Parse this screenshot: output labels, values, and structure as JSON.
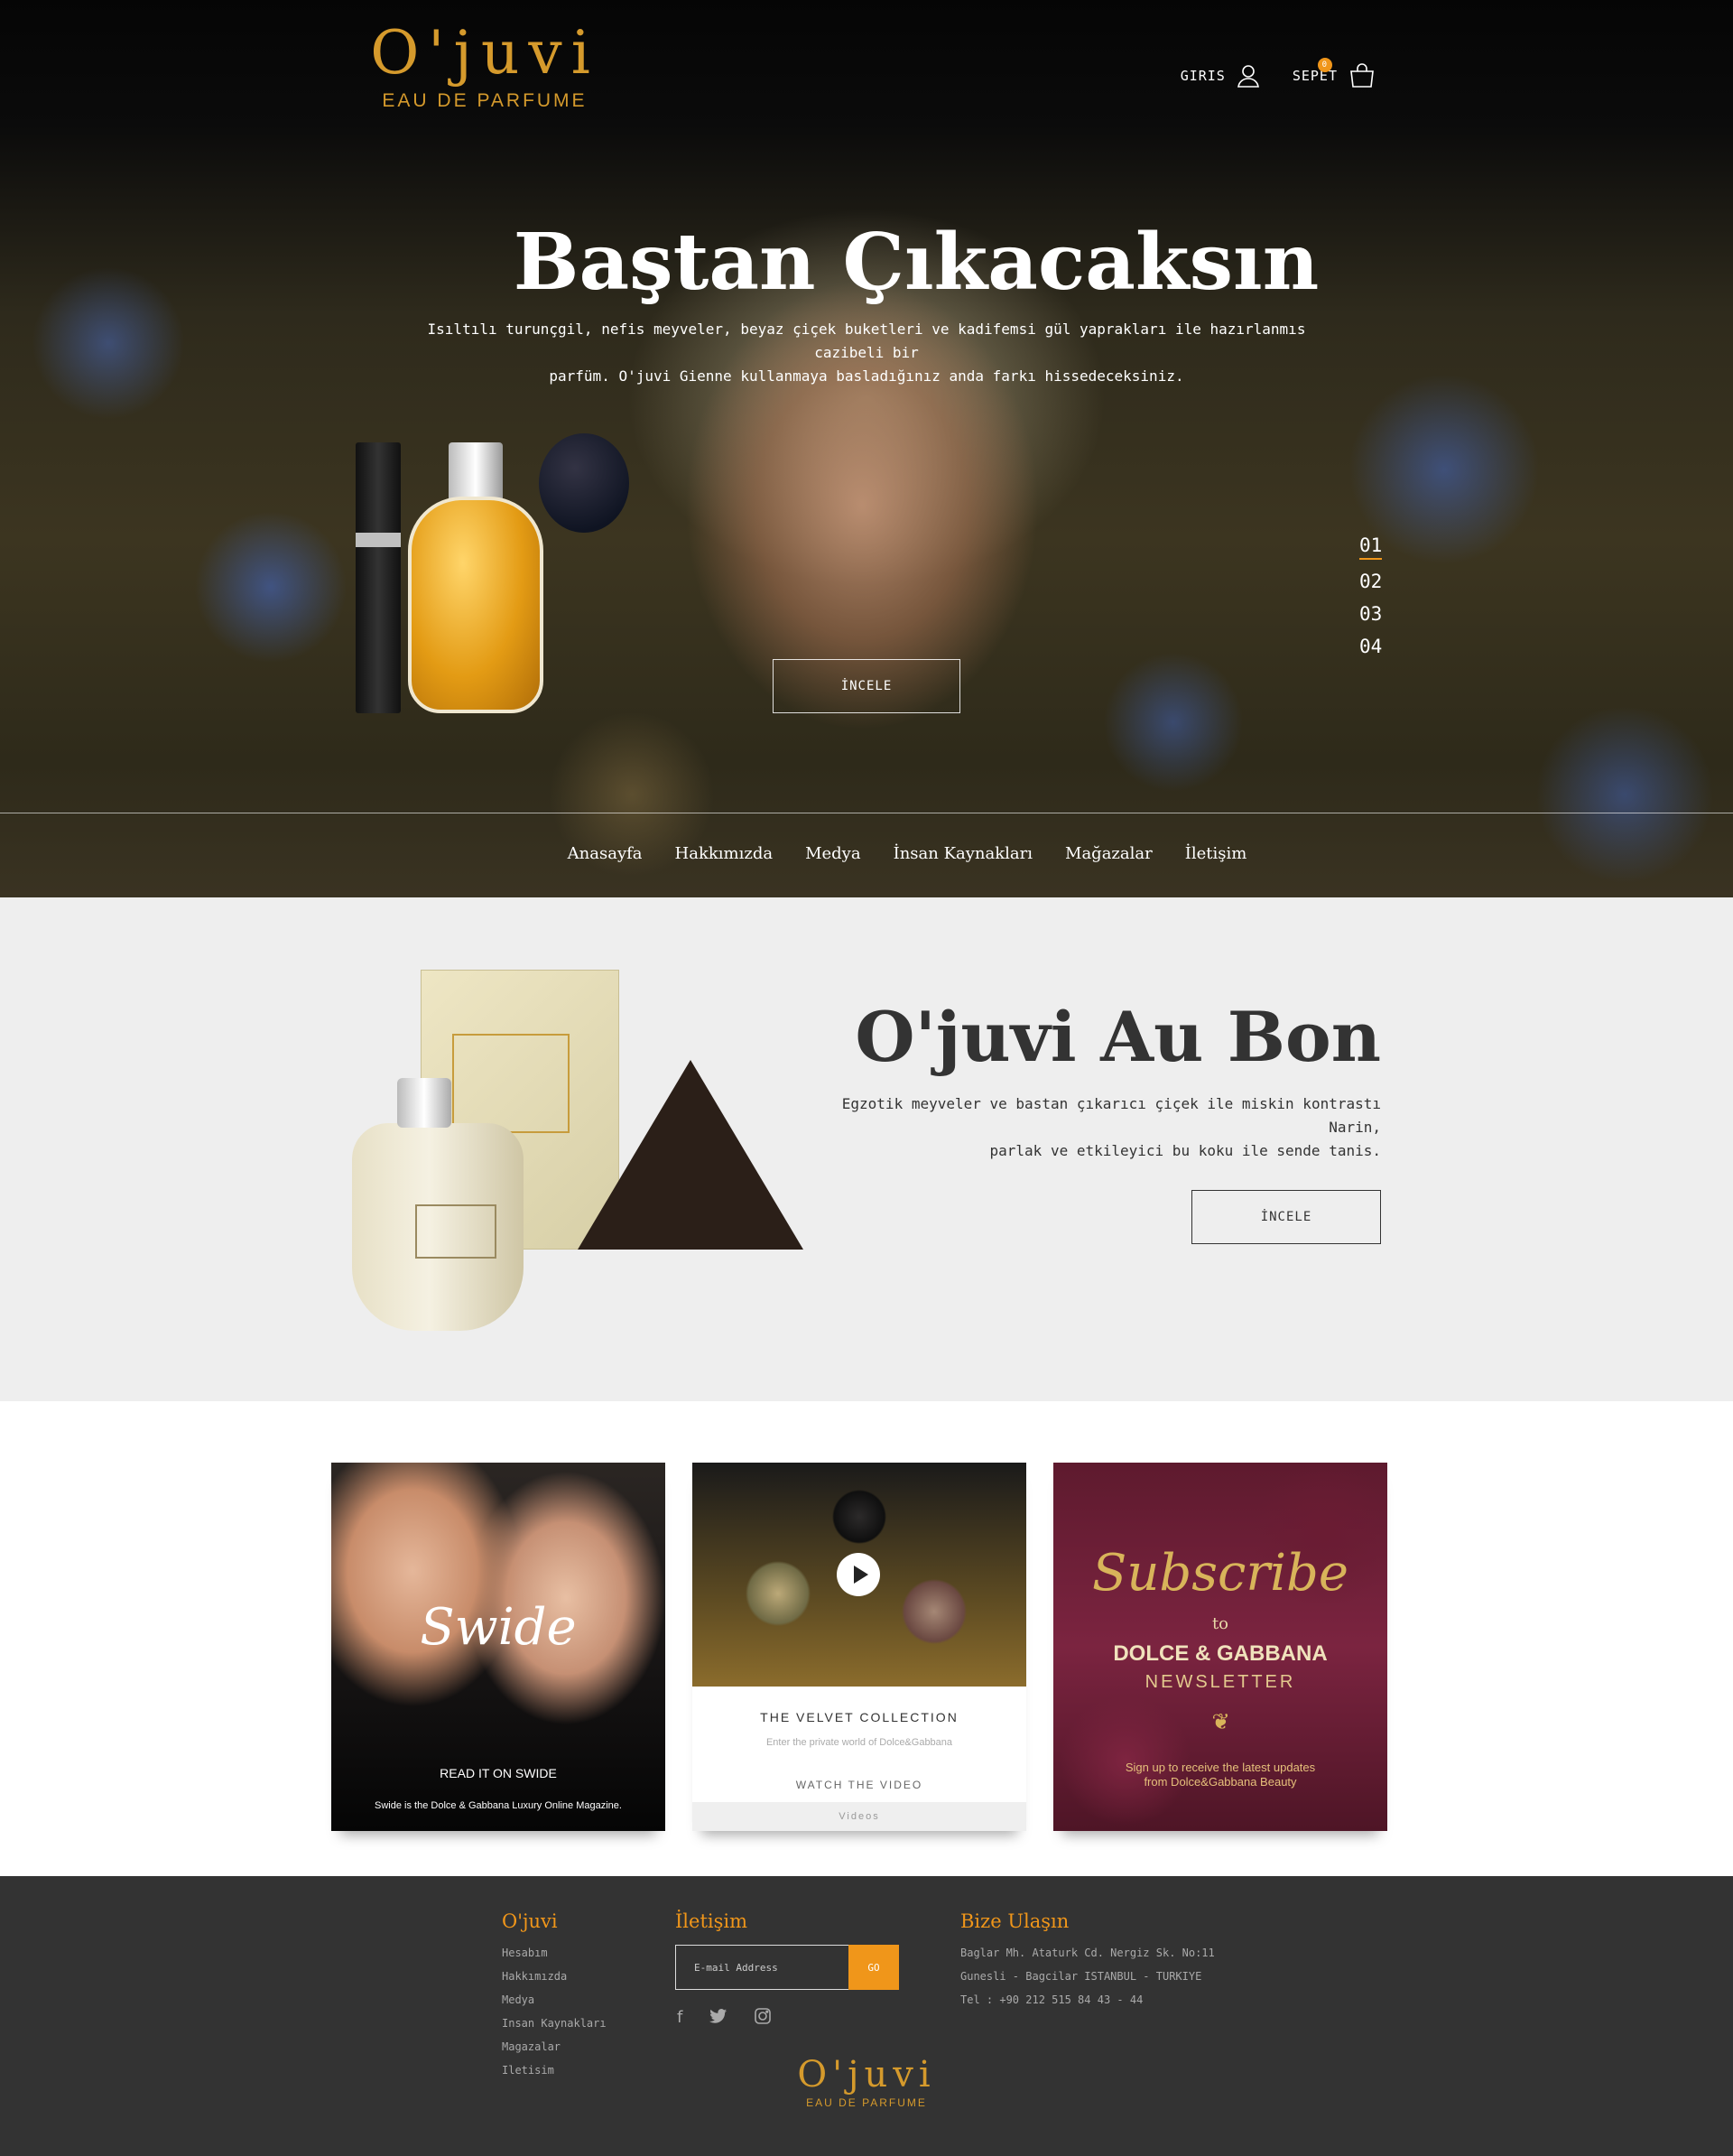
{
  "header": {
    "logo_word": "O'juvi",
    "logo_sub": "EAU DE PARFUME",
    "login_label": "GIRIS",
    "cart_label": "SEPET",
    "cart_count": "0"
  },
  "hero": {
    "title": "Baştan Çıkacaksın",
    "text_line1": "Isıltılı turunçgil, nefis meyveler, beyaz çiçek buketleri ve kadifemsi gül yaprakları ile hazırlanmıs cazibeli bir",
    "text_line2": "parfüm. O'juvi Gienne kullanmaya basladığınız anda farkı hissedeceksiniz.",
    "button": "İNCELE",
    "slides": [
      "01",
      "02",
      "03",
      "04"
    ]
  },
  "nav": {
    "items": [
      "Anasayfa",
      "Hakkımızda",
      "Medya",
      "İnsan Kaynakları",
      "Mağazalar",
      "İletişim"
    ]
  },
  "product": {
    "title": "O'juvi Au Bon",
    "text_line1": "Egzotik meyveler ve bastan çıkarıcı çiçek ile miskin kontrastı Narin,",
    "text_line2": "parlak ve etkileyici bu koku ile sende tanis.",
    "button": "İNCELE"
  },
  "cards": {
    "swide": {
      "title": "Swide",
      "read": "READ IT ON SWIDE",
      "desc": "Swide is the Dolce & Gabbana Luxury Online Magazine."
    },
    "velvet": {
      "title": "THE VELVET COLLECTION",
      "sub": "Enter the private world of Dolce&Gabbana",
      "watch": "WATCH THE VIDEO",
      "videos": "Videos"
    },
    "subscribe": {
      "title": "Subscribe",
      "to": "to",
      "brand": "DOLCE & GABBANA",
      "newsletter": "NEWSLETTER",
      "sign_line1": "Sign up to receive the latest updates",
      "sign_line2": "from Dolce&Gabbana Beauty"
    }
  },
  "footer": {
    "col1_title": "O'juvi",
    "col1_links": [
      "Hesabım",
      "Hakkımızda",
      "Medya",
      "Insan Kaynakları",
      "Magazalar",
      "Iletisim"
    ],
    "col2_title": "İletişim",
    "email_placeholder": "E-mail Address",
    "go_label": "GO",
    "social": [
      "facebook-icon",
      "twitter-icon",
      "instagram-icon"
    ],
    "col3_title": "Bize Ulaşın",
    "address_line1": "Baglar Mh. Ataturk Cd. Nergiz Sk. No:11",
    "address_line2": "Gunesli - Bagcilar ISTANBUL - TURKIYE",
    "phone": "Tel : +90 212 515 84 43 - 44",
    "logo_word": "O'juvi",
    "logo_sub": "EAU DE PARFUME"
  },
  "colors": {
    "accent": "#f0961a",
    "gold": "#d59a2c",
    "footer_bg": "#333333",
    "product_bg": "#eeeeee"
  }
}
